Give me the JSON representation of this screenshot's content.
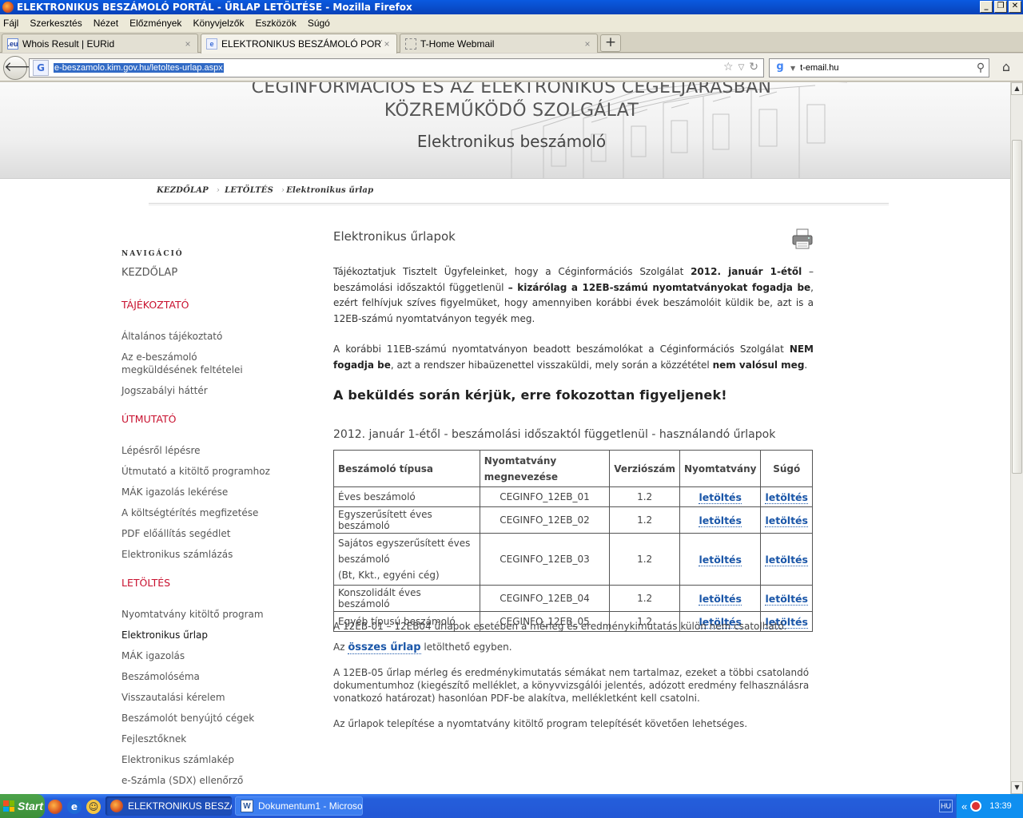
{
  "window": {
    "title": "ELEKTRONIKUS BESZÁMOLÓ PORTÁL - ŰRLAP LETÖLTÉSE - Mozilla Firefox"
  },
  "menu": [
    "Fájl",
    "Szerkesztés",
    "Nézet",
    "Előzmények",
    "Könyvjelzők",
    "Eszközök",
    "Súgó"
  ],
  "tabs": [
    {
      "label": "Whois Result | EURid",
      "icon": ".eu"
    },
    {
      "label": "ELEKTRONIKUS BESZÁMOLÓ PORTÁL - ...",
      "icon": "e"
    },
    {
      "label": "T-Home Webmail",
      "icon": ""
    }
  ],
  "navbar": {
    "url": "e-beszamolo.kim.gov.hu/letoltes-urlap.aspx",
    "search_value": "t-email.hu"
  },
  "banner": {
    "org": "CÉGINFORMÁCIÓS ÉS AZ ELEKTRONIKUS CÉGELJÁRÁSBAN KÖZREMŰKÖDŐ SZOLGÁLAT",
    "subtitle": "Elektronikus beszámoló"
  },
  "breadcrumb": [
    "KEZDŐLAP",
    "LETÖLTÉS",
    "Elektronikus űrlap"
  ],
  "sidebar": {
    "heading": "NAVIGÁCIÓ",
    "home": "KEZDŐLAP",
    "sections": [
      {
        "title": "TÁJÉKOZTATÓ",
        "items": [
          "Általános tájékoztató",
          "Az e-beszámoló megküldésének feltételei",
          "Jogszabályi háttér"
        ]
      },
      {
        "title": "ÚTMUTATÓ",
        "items": [
          "Lépésről lépésre",
          "Útmutató a kitöltő programhoz",
          "MÁK igazolás lekérése",
          "A költségtérítés megfizetése",
          "PDF előállítás segédlet",
          "Elektronikus számlázás"
        ]
      },
      {
        "title": "LETÖLTÉS",
        "items": [
          "Nyomtatvány kitöltő program",
          "Elektronikus űrlap",
          "MÁK igazolás",
          "Beszámolóséma",
          "Visszautalási kérelem",
          "Beszámolót benyújtó cégek",
          "Fejlesztőknek",
          "Elektronikus számlakép",
          "e-Számla (SDX) ellenőrző"
        ]
      }
    ]
  },
  "main": {
    "title": "Elektronikus űrlapok",
    "p1_a": "Tájékoztatjuk Tisztelt Ügyfeleinket, hogy a Céginformációs Szolgálat ",
    "p1_b": "2012. január 1-étől",
    "p1_c": " – beszámolási időszaktól függetlenül ",
    "p1_d": "– kizárólag a 12EB-számú nyomtatványokat fogadja be",
    "p1_e": ", ezért felhívjuk szíves figyelmüket, hogy amennyiben korábbi évek beszámolóit küldik be, azt is a 12EB-számú nyomtatványon tegyék meg.",
    "p2_a": "A korábbi 11EB-számú nyomtatványon beadott beszámolókat a Céginformációs Szolgálat ",
    "p2_b": "NEM fogadja be",
    "p2_c": ", azt a rendszer hibaüzenettel visszaküldi, mely során a közzététel ",
    "p2_d": "nem valósul meg",
    "p2_e": ".",
    "warning": "A beküldés során kérjük, erre fokozottan figyeljenek!",
    "table_title": "2012. január 1-étől - beszámolási időszaktól függetlenül - használandó űrlapok",
    "table": {
      "headers": [
        "Beszámoló típusa",
        "Nyomtatvány megnevezése",
        "Verziószám",
        "Nyomtatvány",
        "Súgó"
      ],
      "rows": [
        {
          "type": "Éves beszámoló",
          "name": "CEGINFO_12EB_01",
          "version": "1.2",
          "form": "letöltés",
          "help": "letöltés"
        },
        {
          "type": "Egyszerűsített éves beszámoló",
          "name": "CEGINFO_12EB_02",
          "version": "1.2",
          "form": "letöltés",
          "help": "letöltés"
        },
        {
          "type": "Sajátos egyszerűsített éves beszámoló",
          "type_note": "(Bt, Kkt., egyéni cég)",
          "name": "CEGINFO_12EB_03",
          "version": "1.2",
          "form": "letöltés",
          "help": "letöltés"
        },
        {
          "type": "Konszolidált éves beszámoló",
          "name": "CEGINFO_12EB_04",
          "version": "1.2",
          "form": "letöltés",
          "help": "letöltés"
        },
        {
          "type": "Egyéb típusú beszámoló",
          "name": "CEGINFO_12EB_05",
          "version": "1.2",
          "form": "letöltés",
          "help": "letöltés"
        }
      ]
    },
    "note1": "A 12EB-01 – 12EB04 űrlapok esetében a mérleg és eredménykimutatás külön nem csatolható.",
    "note2_a": "Az ",
    "note2_link": "összes űrlap",
    "note2_b": " letölthető egyben.",
    "note3": "A 12EB-05 űrlap mérleg és eredménykimutatás sémákat nem tartalmaz, ezeket a többi csatolandó dokumentumhoz (kiegészítő melléklet, a könyvvizsgálói jelentés, adózott eredmény felhasználásra vonatkozó határozat) hasonlóan PDF-be alakítva, mellékletként kell csatolni.",
    "note4": "Az űrlapok telepítése a nyomtatvány kitöltő program telepítését követően lehetséges."
  },
  "taskbar": {
    "start": "Start",
    "items": [
      "ELEKTRONIKUS BESZÁ...",
      "Dokumentum1 - Microsof..."
    ],
    "lang": "HU",
    "time": "13:39"
  },
  "colors": {
    "section_red": "#c8102e",
    "link_blue": "#1a56a8",
    "titlebar_blue": "#0a5ae0"
  }
}
